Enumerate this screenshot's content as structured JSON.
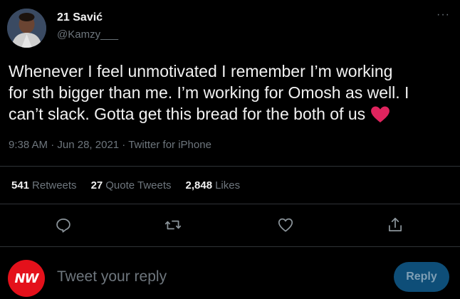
{
  "author": {
    "display_name": "21 Savić",
    "handle": "@Kamzy___"
  },
  "tweet": {
    "text": "Whenever I feel unmotivated I remember I’m working\nfor sth bigger than me. I’m working for Omosh as well. I\ncan’t slack. Gotta get this bread for the both of us",
    "emoji": "red-heart-emoji"
  },
  "meta": {
    "time": "9:38 AM",
    "sep1": " · ",
    "date": "Jun 28, 2021",
    "sep2": " · ",
    "source": "Twitter for iPhone"
  },
  "stats": {
    "retweets_count": "541",
    "retweets_label": "Retweets",
    "quote_count": "27",
    "quote_label": "Quote Tweets",
    "likes_count": "2,848",
    "likes_label": "Likes"
  },
  "actions": {
    "reply_icon": "reply-icon",
    "retweet_icon": "retweet-icon",
    "like_icon": "heart-icon",
    "share_icon": "share-icon"
  },
  "reply_box": {
    "avatar_text": "NW",
    "placeholder": "Tweet your reply",
    "button_label": "Reply"
  },
  "colors": {
    "background": "#000000",
    "muted": "#6e767d",
    "text": "#f2f2f2",
    "reply_button_bg": "#0e4e78",
    "avatar_red": "#e4111b",
    "heart": "#e0245e"
  }
}
